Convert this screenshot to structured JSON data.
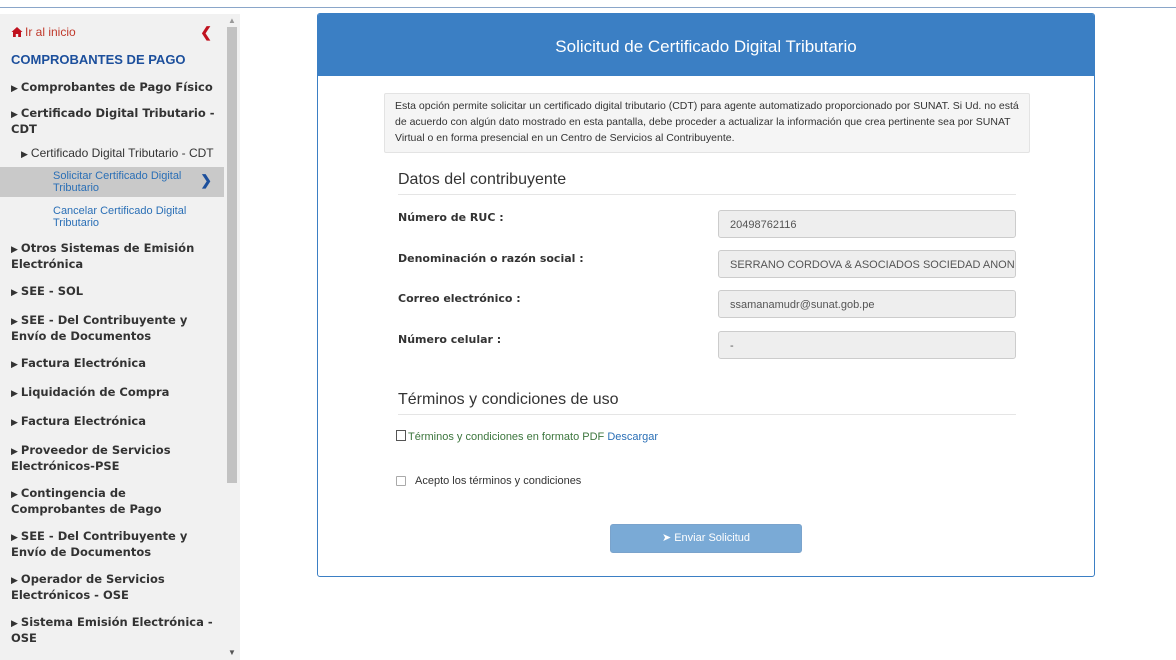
{
  "sidebar": {
    "home_label": "Ir al inicio",
    "title": "COMPROBANTES DE PAGO",
    "items": [
      {
        "label": "Comprobantes de Pago Físico"
      },
      {
        "label": "Certificado Digital Tributario - CDT"
      }
    ],
    "sub_item": "Certificado Digital Tributario - CDT",
    "leaves": [
      {
        "label": "Solicitar Certificado Digital Tributario"
      },
      {
        "label": "Cancelar Certificado Digital Tributario"
      }
    ],
    "more_items": [
      {
        "label": "Otros Sistemas de Emisión Electrónica"
      },
      {
        "label": "SEE - SOL"
      },
      {
        "label": "SEE - Del Contribuyente y Envío de Documentos"
      },
      {
        "label": "Factura Electrónica"
      },
      {
        "label": "Liquidación de Compra"
      },
      {
        "label": "Factura Electrónica"
      },
      {
        "label": "Proveedor de Servicios Electrónicos-PSE"
      },
      {
        "label": "Contingencia de Comprobantes de Pago"
      },
      {
        "label": "SEE - Del Contribuyente y Envío de Documentos"
      },
      {
        "label": "Operador de Servicios Electrónicos - OSE"
      },
      {
        "label": "Sistema Emisión Electrónica - OSE"
      }
    ]
  },
  "panel": {
    "title": "Solicitud de Certificado Digital Tributario",
    "intro": "Esta opción permite solicitar un certificado digital tributario (CDT) para agente automatizado proporcionado por SUNAT. Si Ud. no está de acuerdo con algún dato mostrado en esta pantalla, debe proceder a actualizar la información que crea pertinente sea por SUNAT Virtual o en forma presencial en un Centro de Servicios al Contribuyente.",
    "section_data": "Datos del contribuyente",
    "fields": [
      {
        "label": "Número de RUC :",
        "value": "20498762116"
      },
      {
        "label": "Denominación o razón social :",
        "value": "SERRANO CORDOVA & ASOCIADOS SOCIEDAD ANONIMA CERRADA"
      },
      {
        "label": "Correo electrónico :",
        "value": "ssamanamudr@sunat.gob.pe"
      },
      {
        "label": "Número celular :",
        "value": "-"
      }
    ],
    "section_terms": "Términos y condiciones de uso",
    "terms_link": "Términos y condiciones en formato PDF",
    "download_link": "Descargar",
    "accept_label": "Acepto los términos y condiciones",
    "send_button": "Enviar Solicitud"
  },
  "colors": {
    "primary": "#3b7fc4",
    "nav_title": "#1c4f9c",
    "home": "#c0392b",
    "button_disabled": "#7aaad6"
  }
}
